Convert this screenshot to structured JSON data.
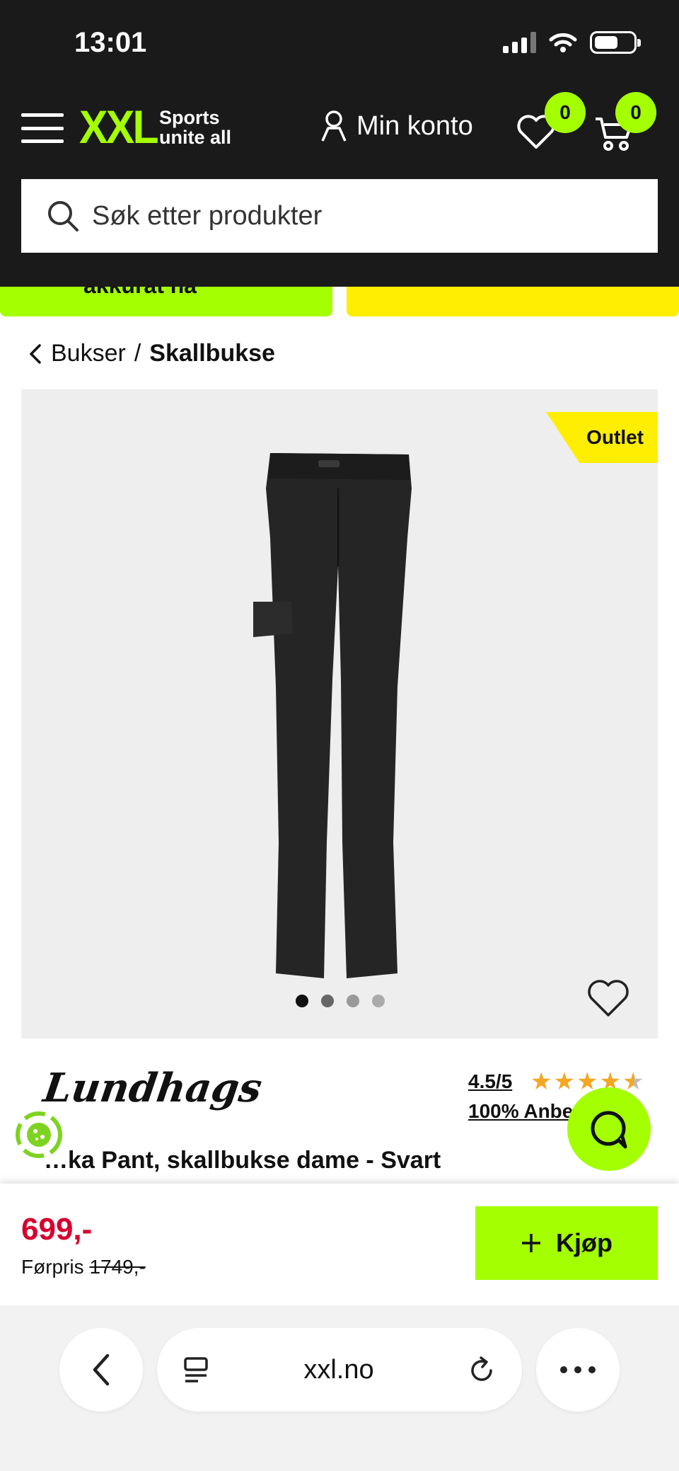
{
  "status_bar": {
    "time": "13:01"
  },
  "header": {
    "logo_text": "XXL",
    "logo_tagline_1": "Sports",
    "logo_tagline_2": "unite all",
    "account_label": "Min konto",
    "wishlist_count": "0",
    "cart_count": "0",
    "brand_color": "#a4ff00"
  },
  "search": {
    "placeholder": "Søk etter produkter"
  },
  "promo": {
    "green_text": "akkurat nå"
  },
  "breadcrumb": {
    "parent": "Bukser",
    "separator": "/",
    "current": "Skallbukse"
  },
  "product": {
    "badge": "Outlet",
    "brand": "Lundhags",
    "rating": "4.5/5",
    "rating_value": 4.5,
    "recommend": "100% Anbe",
    "title": "…ka Pant, skallbukse dame - Svart",
    "image_count": 4,
    "active_image": 1
  },
  "buy_bar": {
    "price": "699,-",
    "previous_label": "Førpris",
    "previous_price": "1749,-",
    "buy_label": "Kjøp",
    "price_color": "#d6002f"
  },
  "browser": {
    "url": "xxl.no"
  }
}
